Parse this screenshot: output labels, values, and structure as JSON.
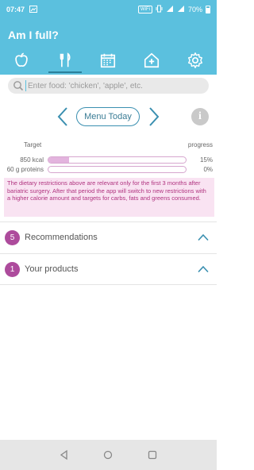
{
  "status_bar": {
    "time": "07:47",
    "wifi_badge": "WiFi",
    "battery": "70%"
  },
  "app": {
    "title": "Am I full?"
  },
  "tabs": [
    {
      "icon": "apple-icon",
      "active": false
    },
    {
      "icon": "fork-knife-icon",
      "active": true
    },
    {
      "icon": "calendar-icon",
      "active": false
    },
    {
      "icon": "hospital-house-icon",
      "active": false
    },
    {
      "icon": "gear-icon",
      "active": false
    }
  ],
  "search": {
    "placeholder": "Enter food: 'chicken', 'apple', etc."
  },
  "nav": {
    "menu_label": "Menu Today",
    "info_label": "i"
  },
  "progress": {
    "target_header": "Target",
    "progress_header": "progress",
    "rows": [
      {
        "label": "850 kcal",
        "percent_text": "15%",
        "fraction": 0.15
      },
      {
        "label": "60 g proteins",
        "percent_text": "0%",
        "fraction": 0.0
      }
    ]
  },
  "notice": "The dietary restrictions above are relevant only for the first 3 months after bariatric surgery. After that period the app will switch to new restrictions with a higher calorie amount and targets for carbs, fats and greens consumed.",
  "sections": [
    {
      "count": "5",
      "title": "Recommendations"
    },
    {
      "count": "1",
      "title": "Your products"
    }
  ],
  "colors": {
    "primary": "#5bc0de",
    "accent": "#ad4b9c",
    "notice_bg": "#f9e3f2",
    "notice_text": "#b0337f"
  }
}
